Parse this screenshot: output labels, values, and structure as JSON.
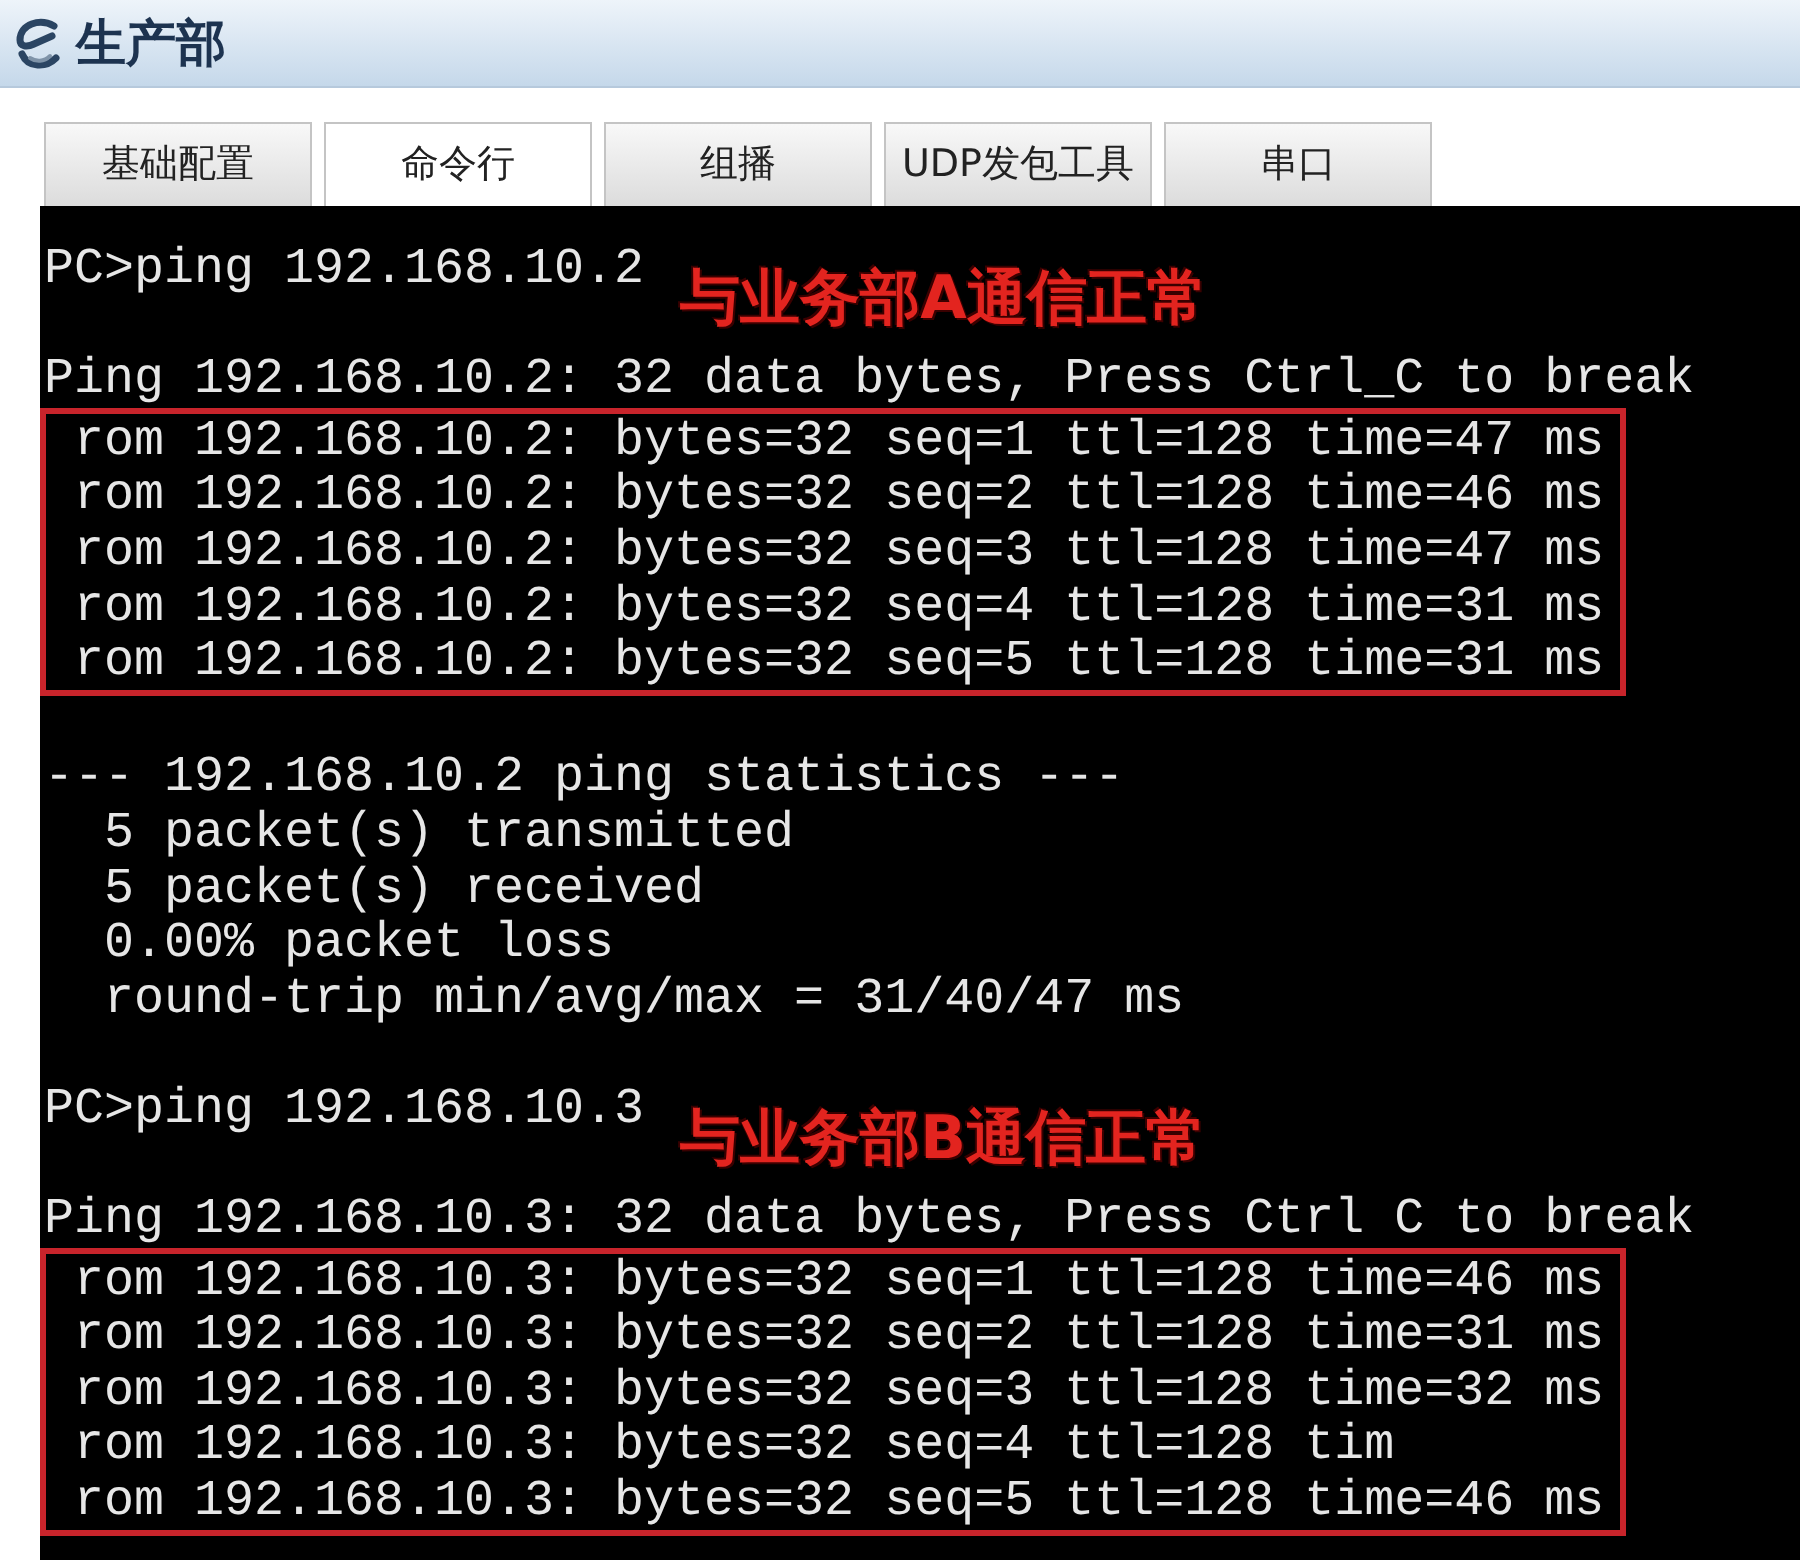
{
  "window": {
    "title": "生产部"
  },
  "tabs": [
    {
      "label": "基础配置",
      "selected": false
    },
    {
      "label": "命令行",
      "selected": true
    },
    {
      "label": "组播",
      "selected": false
    },
    {
      "label": "UDP发包工具",
      "selected": false
    },
    {
      "label": "串口",
      "selected": false
    }
  ],
  "terminal": {
    "lines": [
      {
        "kind": "command",
        "text": "PC>ping 192.168.10.2",
        "note": "与业务部A通信正常"
      },
      {
        "kind": "output",
        "text": "Ping 192.168.10.2: 32 data bytes, Press Ctrl_C to break"
      },
      {
        "kind": "highlighted",
        "lines": [
          "rom 192.168.10.2: bytes=32 seq=1 ttl=128 time=47 ms",
          "rom 192.168.10.2: bytes=32 seq=2 ttl=128 time=46 ms",
          "rom 192.168.10.2: bytes=32 seq=3 ttl=128 time=47 ms",
          "rom 192.168.10.2: bytes=32 seq=4 ttl=128 time=31 ms",
          "rom 192.168.10.2: bytes=32 seq=5 ttl=128 time=31 ms"
        ]
      },
      {
        "kind": "blank"
      },
      {
        "kind": "output",
        "text": "--- 192.168.10.2 ping statistics ---"
      },
      {
        "kind": "output",
        "text": "  5 packet(s) transmitted"
      },
      {
        "kind": "output",
        "text": "  5 packet(s) received"
      },
      {
        "kind": "output",
        "text": "  0.00% packet loss"
      },
      {
        "kind": "output",
        "text": "  round-trip min/avg/max = 31/40/47 ms"
      },
      {
        "kind": "blank"
      },
      {
        "kind": "command",
        "text": "PC>ping 192.168.10.3",
        "note": "与业务部B通信正常"
      },
      {
        "kind": "output",
        "text": "Ping 192.168.10.3: 32 data bytes, Press Ctrl C to break"
      },
      {
        "kind": "highlighted",
        "lines": [
          "rom 192.168.10.3: bytes=32 seq=1 ttl=128 time=46 ms",
          "rom 192.168.10.3: bytes=32 seq=2 ttl=128 time=31 ms",
          "rom 192.168.10.3: bytes=32 seq=3 ttl=128 time=32 ms",
          "rom 192.168.10.3: bytes=32 seq=4 ttl=128 tim",
          "rom 192.168.10.3: bytes=32 seq=5 ttl=128 time=46 ms"
        ]
      }
    ]
  }
}
